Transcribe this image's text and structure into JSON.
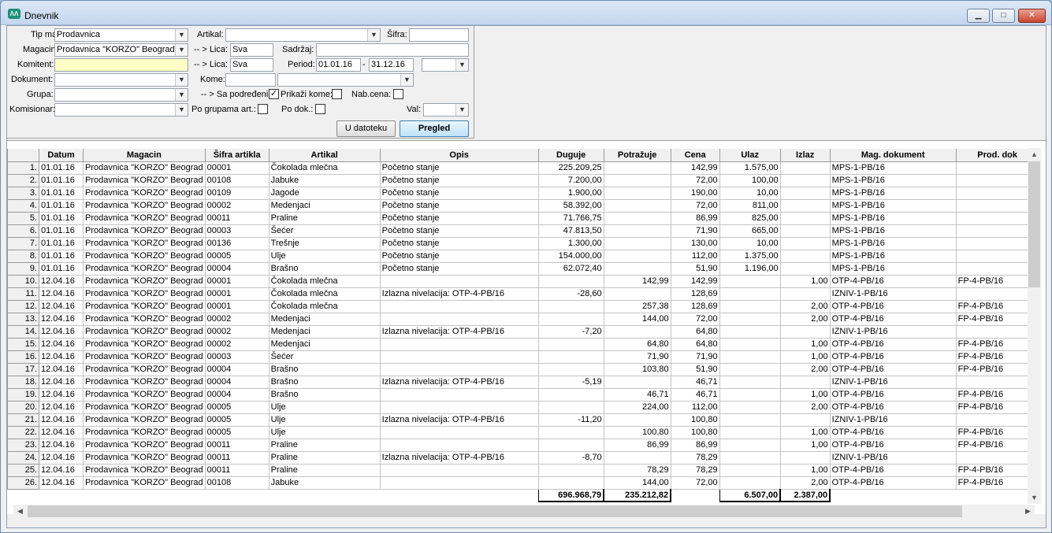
{
  "window": {
    "title": "Dnevnik",
    "icon_text": "ΛΛ"
  },
  "filters": {
    "tip_mag": {
      "label": "Tip mag:",
      "value": "Prodavnica"
    },
    "magacin": {
      "label": "Magacin:",
      "value": "Prodavnica \"KORZO\" Beograd"
    },
    "komitent": {
      "label": "Komitent:",
      "value": ""
    },
    "dokument": {
      "label": "Dokument:",
      "value": ""
    },
    "grupa": {
      "label": "Grupa:",
      "value": ""
    },
    "komisionar": {
      "label": "Komisionar:",
      "value": ""
    },
    "artikal": {
      "label": "Artikal:",
      "value": ""
    },
    "sifra": {
      "label": "Šifra:",
      "value": ""
    },
    "lica1": {
      "label": "-- > Lica:",
      "value": "Sva"
    },
    "lica2": {
      "label": "-- > Lica:",
      "value": "Sva"
    },
    "sadrzaj": {
      "label": "Sadržaj:",
      "value": ""
    },
    "period": {
      "label": "Period:",
      "from": "01.01.16",
      "sep": "-",
      "to": "31.12.16",
      "extra": ""
    },
    "kome": {
      "label": "Kome:",
      "value": "",
      "value2": ""
    },
    "sa_podredjenim": {
      "label": "-- > Sa podređenim:",
      "checked": "✓"
    },
    "prikazi_kome": {
      "label": "Prikaži kome:",
      "checked": ""
    },
    "nab_cena": {
      "label": "Nab.cena:",
      "checked": ""
    },
    "po_grupama": {
      "label": "Po grupama art.:",
      "checked": ""
    },
    "po_dok": {
      "label": "Po dok.:",
      "checked": ""
    },
    "val": {
      "label": "Val:",
      "value": ""
    }
  },
  "buttons": {
    "export": "U datoteku",
    "view": "Pregled"
  },
  "table": {
    "columns": [
      "Datum",
      "Magacin",
      "Šifra artikla",
      "Artikal",
      "Opis",
      "Duguje",
      "Potražuje",
      "Cena",
      "Ulaz",
      "Izlaz",
      "Mag. dokument",
      "Prod. dok"
    ],
    "rows": [
      [
        "1.",
        "01.01.16",
        "Prodavnica \"KORZO\" Beograd",
        "00001",
        "Čokolada mlečna",
        "Početno stanje",
        "225.209,25",
        "",
        "142,99",
        "1.575,00",
        "",
        "MPS-1-PB/16",
        ""
      ],
      [
        "2.",
        "01.01.16",
        "Prodavnica \"KORZO\" Beograd",
        "00108",
        "Jabuke",
        "Početno stanje",
        "7.200,00",
        "",
        "72,00",
        "100,00",
        "",
        "MPS-1-PB/16",
        ""
      ],
      [
        "3.",
        "01.01.16",
        "Prodavnica \"KORZO\" Beograd",
        "00109",
        "Jagode",
        "Početno stanje",
        "1.900,00",
        "",
        "190,00",
        "10,00",
        "",
        "MPS-1-PB/16",
        ""
      ],
      [
        "4.",
        "01.01.16",
        "Prodavnica \"KORZO\" Beograd",
        "00002",
        "Medenjaci",
        "Početno stanje",
        "58.392,00",
        "",
        "72,00",
        "811,00",
        "",
        "MPS-1-PB/16",
        ""
      ],
      [
        "5.",
        "01.01.16",
        "Prodavnica \"KORZO\" Beograd",
        "00011",
        "Praline",
        "Početno stanje",
        "71.766,75",
        "",
        "86,99",
        "825,00",
        "",
        "MPS-1-PB/16",
        ""
      ],
      [
        "6.",
        "01.01.16",
        "Prodavnica \"KORZO\" Beograd",
        "00003",
        "Šećer",
        "Početno stanje",
        "47.813,50",
        "",
        "71,90",
        "665,00",
        "",
        "MPS-1-PB/16",
        ""
      ],
      [
        "7.",
        "01.01.16",
        "Prodavnica \"KORZO\" Beograd",
        "00136",
        "Trešnje",
        "Početno stanje",
        "1.300,00",
        "",
        "130,00",
        "10,00",
        "",
        "MPS-1-PB/16",
        ""
      ],
      [
        "8.",
        "01.01.16",
        "Prodavnica \"KORZO\" Beograd",
        "00005",
        "Ulje",
        "Početno stanje",
        "154.000,00",
        "",
        "112,00",
        "1.375,00",
        "",
        "MPS-1-PB/16",
        ""
      ],
      [
        "9.",
        "01.01.16",
        "Prodavnica \"KORZO\" Beograd",
        "00004",
        "Brašno",
        "Početno stanje",
        "62.072,40",
        "",
        "51,90",
        "1.196,00",
        "",
        "MPS-1-PB/16",
        ""
      ],
      [
        "10.",
        "12.04.16",
        "Prodavnica \"KORZO\" Beograd",
        "00001",
        "Čokolada mlečna",
        "",
        "",
        "142,99",
        "142,99",
        "",
        "1,00",
        "OTP-4-PB/16",
        "FP-4-PB/16"
      ],
      [
        "11.",
        "12.04.16",
        "Prodavnica \"KORZO\" Beograd",
        "00001",
        "Čokolada mlečna",
        "Izlazna nivelacija: OTP-4-PB/16",
        "-28,60",
        "",
        "128,69",
        "",
        "",
        "IZNIV-1-PB/16",
        ""
      ],
      [
        "12.",
        "12.04.16",
        "Prodavnica \"KORZO\" Beograd",
        "00001",
        "Čokolada mlečna",
        "",
        "",
        "257,38",
        "128,69",
        "",
        "2,00",
        "OTP-4-PB/16",
        "FP-4-PB/16"
      ],
      [
        "13.",
        "12.04.16",
        "Prodavnica \"KORZO\" Beograd",
        "00002",
        "Medenjaci",
        "",
        "",
        "144,00",
        "72,00",
        "",
        "2,00",
        "OTP-4-PB/16",
        "FP-4-PB/16"
      ],
      [
        "14.",
        "12.04.16",
        "Prodavnica \"KORZO\" Beograd",
        "00002",
        "Medenjaci",
        "Izlazna nivelacija: OTP-4-PB/16",
        "-7,20",
        "",
        "64,80",
        "",
        "",
        "IZNIV-1-PB/16",
        ""
      ],
      [
        "15.",
        "12.04.16",
        "Prodavnica \"KORZO\" Beograd",
        "00002",
        "Medenjaci",
        "",
        "",
        "64,80",
        "64,80",
        "",
        "1,00",
        "OTP-4-PB/16",
        "FP-4-PB/16"
      ],
      [
        "16.",
        "12.04.16",
        "Prodavnica \"KORZO\" Beograd",
        "00003",
        "Šećer",
        "",
        "",
        "71,90",
        "71,90",
        "",
        "1,00",
        "OTP-4-PB/16",
        "FP-4-PB/16"
      ],
      [
        "17.",
        "12.04.16",
        "Prodavnica \"KORZO\" Beograd",
        "00004",
        "Brašno",
        "",
        "",
        "103,80",
        "51,90",
        "",
        "2,00",
        "OTP-4-PB/16",
        "FP-4-PB/16"
      ],
      [
        "18.",
        "12.04.16",
        "Prodavnica \"KORZO\" Beograd",
        "00004",
        "Brašno",
        "Izlazna nivelacija: OTP-4-PB/16",
        "-5,19",
        "",
        "46,71",
        "",
        "",
        "IZNIV-1-PB/16",
        ""
      ],
      [
        "19.",
        "12.04.16",
        "Prodavnica \"KORZO\" Beograd",
        "00004",
        "Brašno",
        "",
        "",
        "46,71",
        "46,71",
        "",
        "1,00",
        "OTP-4-PB/16",
        "FP-4-PB/16"
      ],
      [
        "20.",
        "12.04.16",
        "Prodavnica \"KORZO\" Beograd",
        "00005",
        "Ulje",
        "",
        "",
        "224,00",
        "112,00",
        "",
        "2,00",
        "OTP-4-PB/16",
        "FP-4-PB/16"
      ],
      [
        "21.",
        "12.04.16",
        "Prodavnica \"KORZO\" Beograd",
        "00005",
        "Ulje",
        "Izlazna nivelacija: OTP-4-PB/16",
        "-11,20",
        "",
        "100,80",
        "",
        "",
        "IZNIV-1-PB/16",
        ""
      ],
      [
        "22.",
        "12.04.16",
        "Prodavnica \"KORZO\" Beograd",
        "00005",
        "Ulje",
        "",
        "",
        "100,80",
        "100,80",
        "",
        "1,00",
        "OTP-4-PB/16",
        "FP-4-PB/16"
      ],
      [
        "23.",
        "12.04.16",
        "Prodavnica \"KORZO\" Beograd",
        "00011",
        "Praline",
        "",
        "",
        "86,99",
        "86,99",
        "",
        "1,00",
        "OTP-4-PB/16",
        "FP-4-PB/16"
      ],
      [
        "24.",
        "12.04.16",
        "Prodavnica \"KORZO\" Beograd",
        "00011",
        "Praline",
        "Izlazna nivelacija: OTP-4-PB/16",
        "-8,70",
        "",
        "78,29",
        "",
        "",
        "IZNIV-1-PB/16",
        ""
      ],
      [
        "25.",
        "12.04.16",
        "Prodavnica \"KORZO\" Beograd",
        "00011",
        "Praline",
        "",
        "",
        "78,29",
        "78,29",
        "",
        "1,00",
        "OTP-4-PB/16",
        "FP-4-PB/16"
      ],
      [
        "26.",
        "12.04.16",
        "Prodavnica \"KORZO\" Beograd",
        "00108",
        "Jabuke",
        "",
        "",
        "144,00",
        "72,00",
        "",
        "2,00",
        "OTP-4-PB/16",
        "FP-4-PB/16"
      ]
    ],
    "totals": {
      "duguje": "696.968,79",
      "potrazuje": "235.212,82",
      "ulaz": "6.507,00",
      "izlaz": "2.387,00"
    }
  }
}
